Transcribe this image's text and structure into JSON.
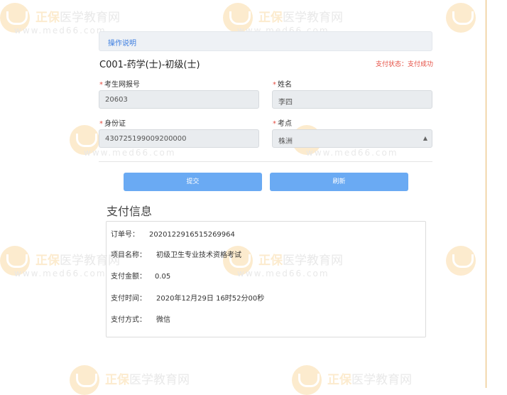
{
  "watermark": {
    "brand": "正保",
    "name": "医学教育网",
    "url": "www.med66.com"
  },
  "help": {
    "label": "操作说明"
  },
  "course": {
    "title": "C001-药学(士)-初级(士)",
    "status": "支付状态：支付成功"
  },
  "form": {
    "exam_no": {
      "label": "考生网报号",
      "value": "20603"
    },
    "name": {
      "label": "姓名",
      "value": "李四"
    },
    "id_card": {
      "label": "身份证",
      "value": "430725199009200000"
    },
    "exam_site": {
      "label": "考点",
      "value": "株洲"
    }
  },
  "buttons": {
    "submit": "提交",
    "refresh": "刷新"
  },
  "payment": {
    "title": "支付信息",
    "rows": [
      {
        "label": "订单号：",
        "value": "2020122916515269964"
      },
      {
        "label": "项目名称：",
        "value": "初级卫生专业技术资格考试"
      },
      {
        "label": "支付金额：",
        "value": "0.05"
      },
      {
        "label": "支付时间：",
        "value": "2020年12月29日 16时52分00秒"
      },
      {
        "label": "支付方式：",
        "value": "微信"
      }
    ]
  }
}
